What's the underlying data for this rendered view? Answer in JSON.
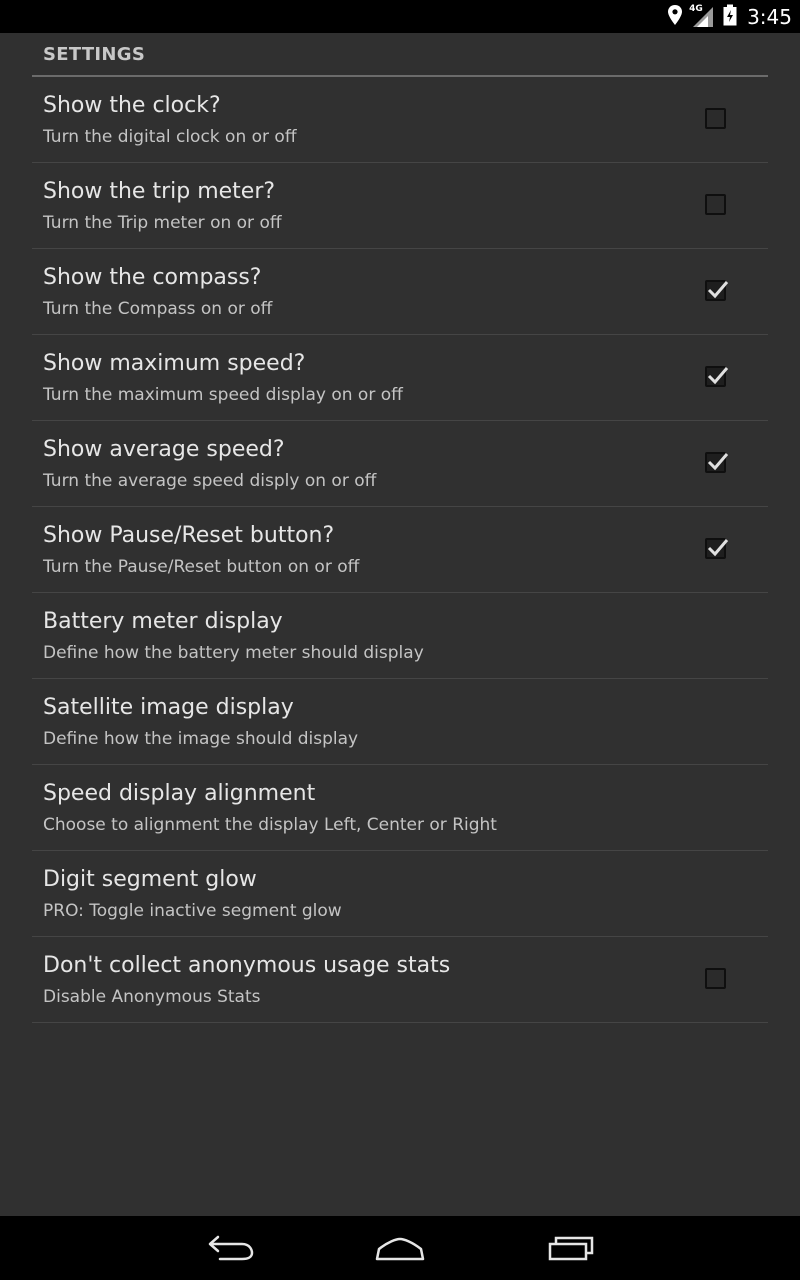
{
  "status_bar": {
    "time": "3:45",
    "network_label": "4G",
    "icons": [
      "location-icon",
      "signal-icon",
      "battery-icon"
    ]
  },
  "settings": {
    "section_title": "SETTINGS",
    "items": [
      {
        "title": "Show the clock?",
        "summary": "Turn the digital clock on or off",
        "has_checkbox": true,
        "checked": false
      },
      {
        "title": "Show the trip meter?",
        "summary": "Turn the Trip meter on or off",
        "has_checkbox": true,
        "checked": false
      },
      {
        "title": "Show the compass?",
        "summary": "Turn the Compass on or off",
        "has_checkbox": true,
        "checked": true
      },
      {
        "title": "Show maximum speed?",
        "summary": "Turn the maximum speed display on or off",
        "has_checkbox": true,
        "checked": true
      },
      {
        "title": "Show average speed?",
        "summary": "Turn the average speed disply on or off",
        "has_checkbox": true,
        "checked": true
      },
      {
        "title": "Show Pause/Reset button?",
        "summary": "Turn the Pause/Reset button on or off",
        "has_checkbox": true,
        "checked": true
      },
      {
        "title": "Battery meter display",
        "summary": "Define how the battery meter should display",
        "has_checkbox": false
      },
      {
        "title": "Satellite image display",
        "summary": "Define how the image should display",
        "has_checkbox": false
      },
      {
        "title": "Speed display alignment",
        "summary": "Choose to alignment the display Left, Center or Right",
        "has_checkbox": false
      },
      {
        "title": "Digit segment glow",
        "summary": "PRO: Toggle inactive segment glow",
        "has_checkbox": false
      },
      {
        "title": "Don't collect anonymous usage stats",
        "summary": "Disable Anonymous Stats",
        "has_checkbox": true,
        "checked": false
      }
    ]
  },
  "nav_bar": {
    "buttons": [
      "back-icon",
      "home-icon",
      "recent-apps-icon"
    ]
  },
  "colors": {
    "background": "#303030",
    "bars": "#000000",
    "title_text": "#e6e6e6",
    "summary_text": "#c4c4c4",
    "divider": "#454545"
  }
}
